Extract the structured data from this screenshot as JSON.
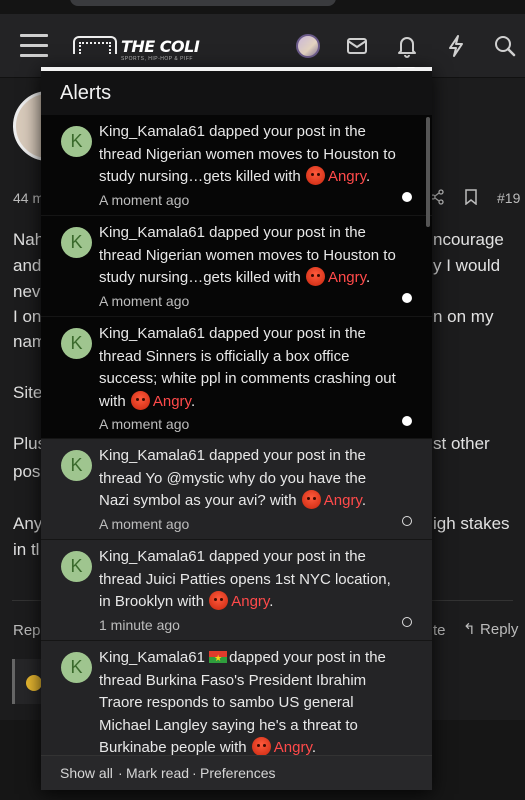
{
  "header": {
    "logo_name": "THE COLI",
    "logo_tagline": "SPORTS, HIP-HOP & PIFF"
  },
  "background_post": {
    "time": "44 m",
    "post_number": "#19",
    "lines_left": [
      "Nah",
      "and",
      "nev",
      "I on",
      "nam",
      "Site",
      "Plus",
      "pos",
      "Any",
      "in tl"
    ],
    "lines_right": [
      "ncourage",
      "y I would",
      "n on my",
      "st other",
      "igh stakes"
    ],
    "reply_left": "Rep",
    "reply_right_fragment": "te",
    "reply_label": "Reply"
  },
  "alerts": {
    "title": "Alerts",
    "items": [
      {
        "avatar_letter": "K",
        "user": "King_Kamala61",
        "text": "dapped your post in the thread Nigerian women moves to Houston to study nursing…gets killed with",
        "reaction": "Angry",
        "time": "A moment ago",
        "unread": true
      },
      {
        "avatar_letter": "K",
        "user": "King_Kamala61",
        "text": "dapped your post in the thread Nigerian women moves to Houston to study nursing…gets killed with",
        "reaction": "Angry",
        "time": "A moment ago",
        "unread": true
      },
      {
        "avatar_letter": "K",
        "user": "King_Kamala61",
        "text": "dapped your post in the thread Sinners is officially a box office success; white ppl in comments crashing out with",
        "reaction": "Angry",
        "time": "A moment ago",
        "unread": true
      },
      {
        "avatar_letter": "K",
        "user": "King_Kamala61",
        "text": "dapped your post in the thread Yo @mystic why do you have the Nazi symbol as your avi? with",
        "reaction": "Angry",
        "time": "A moment ago",
        "unread": false
      },
      {
        "avatar_letter": "K",
        "user": "King_Kamala61",
        "text": "dapped your post in the thread Juici Patties opens 1st NYC location, in Brooklyn with",
        "reaction": "Angry",
        "time": "1 minute ago",
        "unread": false
      },
      {
        "avatar_letter": "K",
        "user": "King_Kamala61",
        "text": "dapped your post in the thread Burkina Faso's President Ibrahim Traore responds to sambo US general Michael Langley saying he's a threat to Burkinabe people with",
        "reaction": "Angry",
        "time": "",
        "unread": false
      }
    ],
    "footer": {
      "show_all": "Show all",
      "mark_read": "Mark read",
      "preferences": "Preferences",
      "separator": "·"
    }
  },
  "icons": {
    "menu": "hamburger-menu-icon",
    "messages": "envelope-icon",
    "alerts": "bell-icon",
    "whats_new": "lightning-icon",
    "search": "search-icon",
    "reaction": "angry-face-emoji-icon",
    "flag": "burkina-faso-flag-icon"
  },
  "colors": {
    "reaction_text": "#ff4a4a",
    "avatar_bg": "#9fc58f",
    "unread_bg": "#060606",
    "read_bg": "#242426"
  }
}
